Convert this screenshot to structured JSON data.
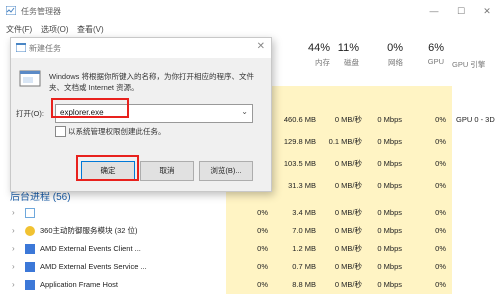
{
  "window": {
    "title": "任务管理器",
    "menu": [
      "文件(F)",
      "选项(O)",
      "查看(V)"
    ]
  },
  "columns": [
    {
      "pct": "44%",
      "label": "内存"
    },
    {
      "pct": "11%",
      "label": "磁盘"
    },
    {
      "pct": "0%",
      "label": "网络"
    },
    {
      "pct": "6%",
      "label": "GPU"
    },
    {
      "pct": "",
      "label": "GPU 引擎"
    }
  ],
  "partial_rows": [
    {
      "mem": "460.6 MB",
      "disk": "0 MB/秒",
      "net": "0 Mbps",
      "gpu": "0%",
      "engine": "GPU 0 - 3D"
    },
    {
      "mem": "129.8 MB",
      "disk": "0.1 MB/秒",
      "net": "0 Mbps",
      "gpu": "0%",
      "engine": ""
    },
    {
      "mem": "103.5 MB",
      "disk": "0 MB/秒",
      "net": "0 Mbps",
      "gpu": "0%",
      "engine": ""
    },
    {
      "mem": "31.3 MB",
      "disk": "0 MB/秒",
      "net": "0 Mbps",
      "gpu": "0%",
      "engine": ""
    }
  ],
  "group_header": "后台进程 (56)",
  "processes": [
    {
      "name": "",
      "cpu": "0%",
      "mem": "3.4 MB",
      "disk": "0 MB/秒",
      "net": "0 Mbps",
      "gpu": "0%",
      "icon": "gear-icon",
      "color": "#6fa8dc"
    },
    {
      "name": "360主动防御服务模块 (32 位)",
      "cpu": "0%",
      "mem": "7.0 MB",
      "disk": "0 MB/秒",
      "net": "0 Mbps",
      "gpu": "0%",
      "icon": "shield-icon",
      "color": "#f1c232"
    },
    {
      "name": "AMD External Events Client ...",
      "cpu": "0%",
      "mem": "1.2 MB",
      "disk": "0 MB/秒",
      "net": "0 Mbps",
      "gpu": "0%",
      "icon": "app-icon",
      "color": "#3c78d8"
    },
    {
      "name": "AMD External Events Service ...",
      "cpu": "0%",
      "mem": "0.7 MB",
      "disk": "0 MB/秒",
      "net": "0 Mbps",
      "gpu": "0%",
      "icon": "app-icon",
      "color": "#3c78d8"
    },
    {
      "name": "Application Frame Host",
      "cpu": "0%",
      "mem": "8.8 MB",
      "disk": "0 MB/秒",
      "net": "0 Mbps",
      "gpu": "0%",
      "icon": "app-icon",
      "color": "#3c78d8"
    }
  ],
  "run_dialog": {
    "title": "新建任务",
    "description": "Windows 将根据你所键入的名称，为你打开相应的程序、文件夹、文档或 Internet 资源。",
    "open_label": "打开(O):",
    "input_value": "explorer.exe",
    "checkbox_label": "以系统管理权限创建此任务。",
    "ok": "确定",
    "cancel": "取消",
    "browse": "浏览(B)..."
  },
  "colors": {
    "heat": "#fff4c4",
    "highlight": "#e8211d",
    "accent": "#0078d7"
  }
}
